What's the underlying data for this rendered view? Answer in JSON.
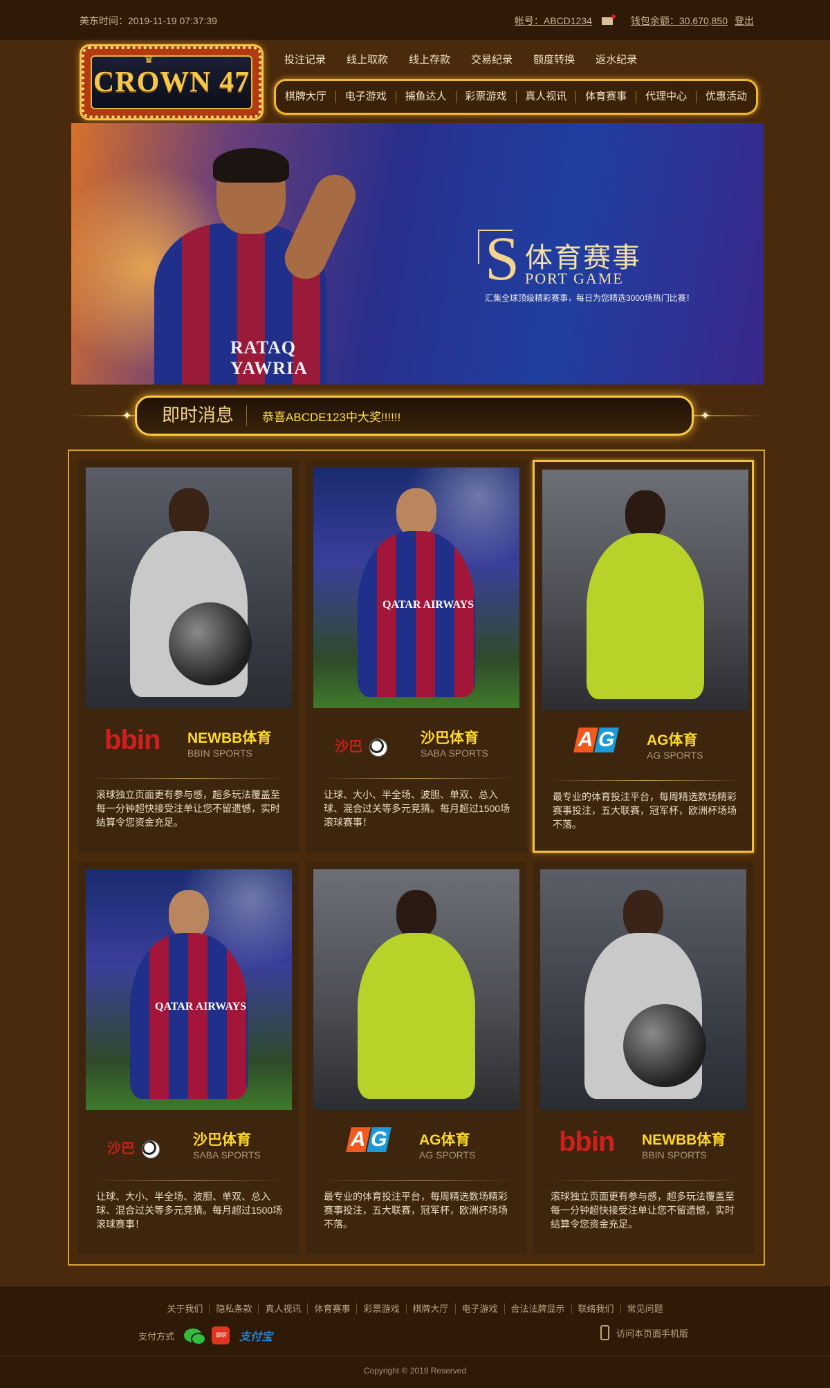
{
  "topbar": {
    "time_label": "美东时间：",
    "time_value": "2019-11-19 07:37:39",
    "account_label": "帐号：ABCD1234",
    "balance_label": "钱包余额：30,670,850",
    "logout": "登出"
  },
  "logo": {
    "text": "CROWN 47"
  },
  "nav_primary": [
    "投注记录",
    "线上取款",
    "线上存款",
    "交易纪录",
    "额度转换",
    "返水纪录"
  ],
  "nav_secondary": [
    "棋牌大厅",
    "电子游戏",
    "捕鱼达人",
    "彩票游戏",
    "真人视讯",
    "体育赛事",
    "代理中心",
    "优惠活动"
  ],
  "banner": {
    "big_letter": "S",
    "title_cn": "体育赛事",
    "title_en": "PORT GAME",
    "subtitle": "汇集全球顶级精彩赛事，每日为您精选3000场热门比赛！",
    "shirt_sponsor": "RATAQ YAWRIA"
  },
  "ticker": {
    "label": "即时消息",
    "message": "恭喜ABCDE123中大奖!!!!!!"
  },
  "cards": [
    {
      "brand": "bbin",
      "logo_text": "bbin",
      "name": "NEWBB体育",
      "en": "BBIN SPORTS",
      "desc": "滚球独立页面更有参与感，超多玩法覆盖至每一分钟超快接受注单让您不留遗憾，实时结算令您资金充足。"
    },
    {
      "brand": "saba",
      "logo_text": "沙巴",
      "name": "沙巴体育",
      "en": "SABA SPORTS",
      "desc": "让球、大小、半全场、波胆、单双、总入球、混合过关等多元竞猜。每月超过1500场滚球赛事！"
    },
    {
      "brand": "ag",
      "logo_text": "AG",
      "name": "AG体育",
      "en": "AG SPORTS",
      "desc": "最专业的体育投注平台，每周精选数场精彩赛事投注，五大联赛，冠军杯，欧洲杯场场不落。"
    },
    {
      "brand": "saba",
      "logo_text": "沙巴",
      "name": "沙巴体育",
      "en": "SABA SPORTS",
      "desc": "让球、大小、半全场、波胆、单双、总入球、混合过关等多元竞猜。每月超过1500场滚球赛事！"
    },
    {
      "brand": "ag",
      "logo_text": "AG",
      "name": "AG体育",
      "en": "AG SPORTS",
      "desc": "最专业的体育投注平台，每周精选数场精彩赛事投注，五大联赛，冠军杯，欧洲杯场场不落。"
    },
    {
      "brand": "bbin",
      "logo_text": "bbin",
      "name": "NEWBB体育",
      "en": "BBIN SPORTS",
      "desc": "滚球独立页面更有参与感，超多玩法覆盖至每一分钟超快接受注单让您不留遗憾，实时结算令您资金充足。"
    }
  ],
  "photo_texts": {
    "qatar": "QATAR AIRWAYS"
  },
  "footer": {
    "links": [
      "关于我们",
      "隐私条款",
      "真人视讯",
      "体育赛事",
      "彩票游戏",
      "棋牌大厅",
      "电子游戏",
      "合法法牌显示",
      "联络我们",
      "常见问题"
    ],
    "pay_label": "支付方式",
    "pay_unionpay": "银联",
    "pay_alipay": "支付宝",
    "mobile_label": "访问本页面手机版",
    "copyright": "Copyright © 2019 Reserved"
  },
  "colors": {
    "background": "#4a2a0c",
    "bar": "#2e1a07",
    "gold": "#f2b833",
    "highlight_yellow": "#ffd928"
  }
}
